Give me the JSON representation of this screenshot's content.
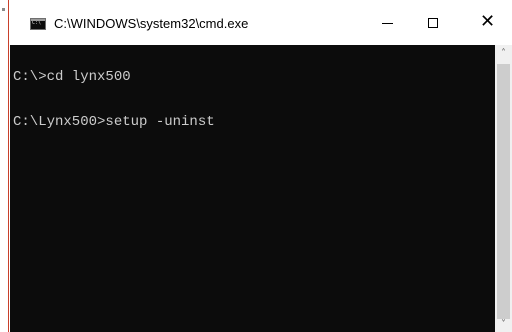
{
  "window": {
    "title": "C:\\WINDOWS\\system32\\cmd.exe",
    "icon": "console-app-icon",
    "icon_text": "C:\\"
  },
  "controls": {
    "minimize": "minimize-icon",
    "maximize": "maximize-icon",
    "close": "close-icon",
    "close_glyph": "✕"
  },
  "console": {
    "lines": [
      "C:\\>cd lynx500",
      "C:\\Lynx500>setup -uninst"
    ],
    "background": "#0c0c0c",
    "foreground": "#cccccc"
  },
  "scrollbar": {
    "up_glyph": "˄",
    "down_glyph": "˅"
  }
}
